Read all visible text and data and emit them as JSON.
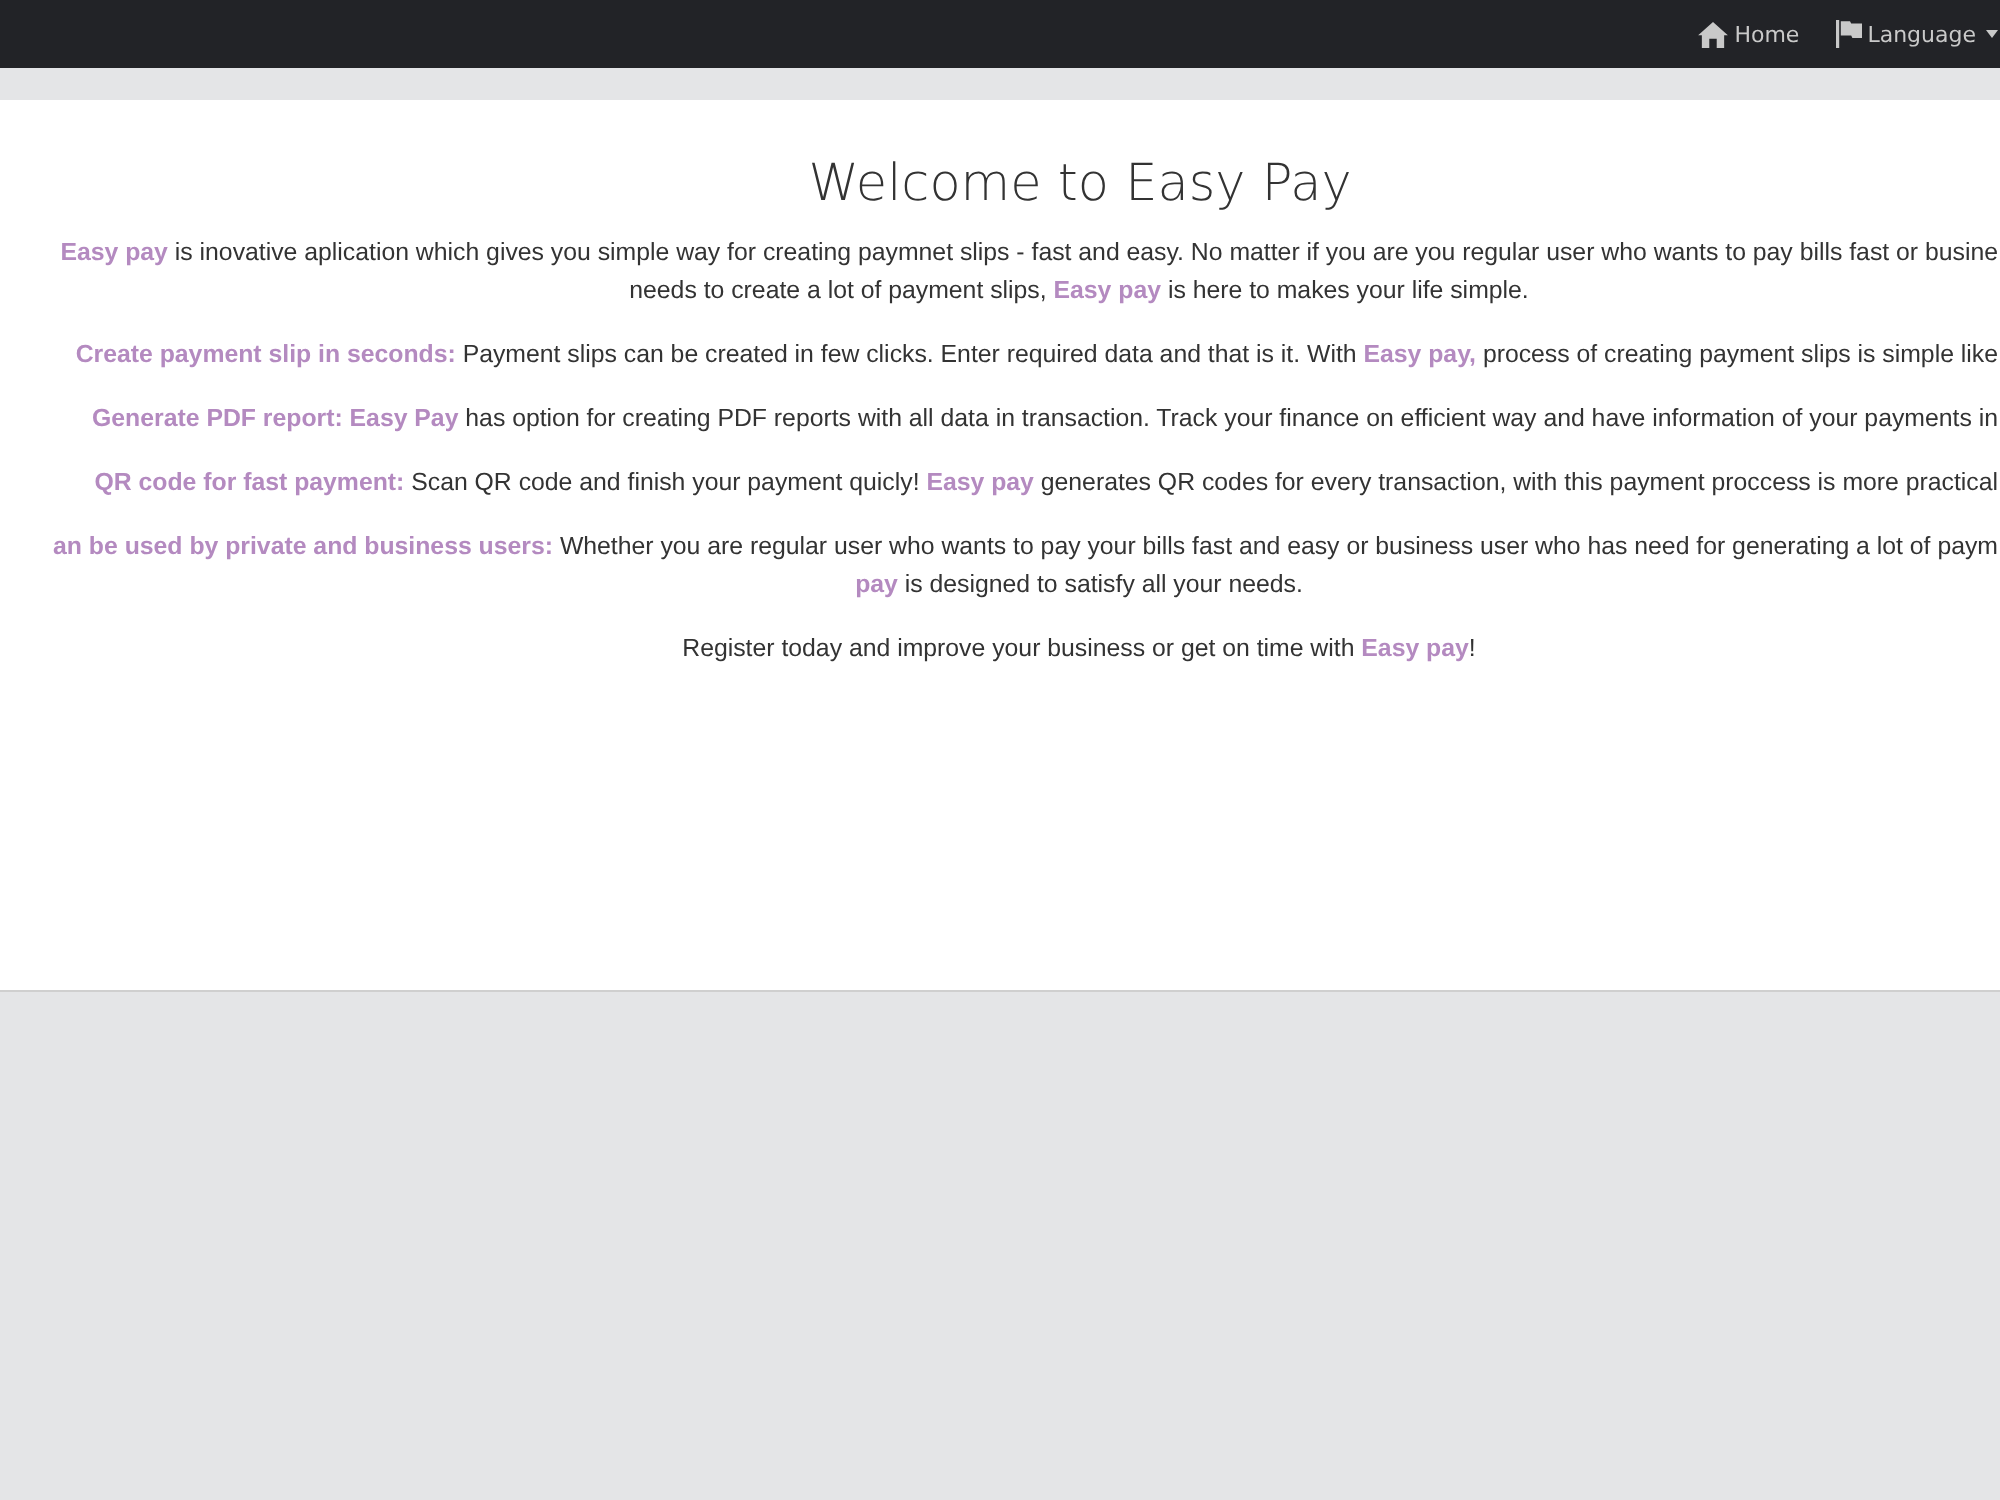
{
  "navbar": {
    "items": [
      {
        "label": "Home",
        "kind": "link"
      },
      {
        "label": "Language",
        "kind": "dropdown"
      }
    ]
  },
  "content": {
    "title": "Welcome to Easy Pay",
    "paragraphs": [
      {
        "lines": [
          "**Easy pay** is inovative aplication which gives you simple way for creating paymnet slips - fast and easy. No matter if you are you regular user who wants to pay bills fast or busine",
          "needs to create a lot of payment slips, **Easy pay** is here to makes your life simple."
        ]
      },
      {
        "lines": [
          "**Create payment slip in seconds:** Payment slips can be created in few clicks. Enter required data and that is it. With **Easy pay,** process of creating payment slips is simple like"
        ]
      },
      {
        "lines": [
          "**Generate PDF report: Easy Pay** has option for creating PDF reports with all data in transaction. Track your finance on efficient way and have information of your payments in"
        ]
      },
      {
        "lines": [
          "**QR code for fast payment:** Scan QR code and finish your payment quicly! **Easy pay** generates QR codes for every transaction, with this payment proccess is more practical"
        ]
      },
      {
        "lines": [
          "**an be used by private and business users:** Whether you are regular user who wants to pay your bills fast and easy or business user who has need for generating a lot of paym",
          "**pay** is designed to satisfy all your needs."
        ]
      },
      {
        "lines": [
          "Register today and improve your business or get on time with **Easy pay**!"
        ]
      }
    ]
  }
}
